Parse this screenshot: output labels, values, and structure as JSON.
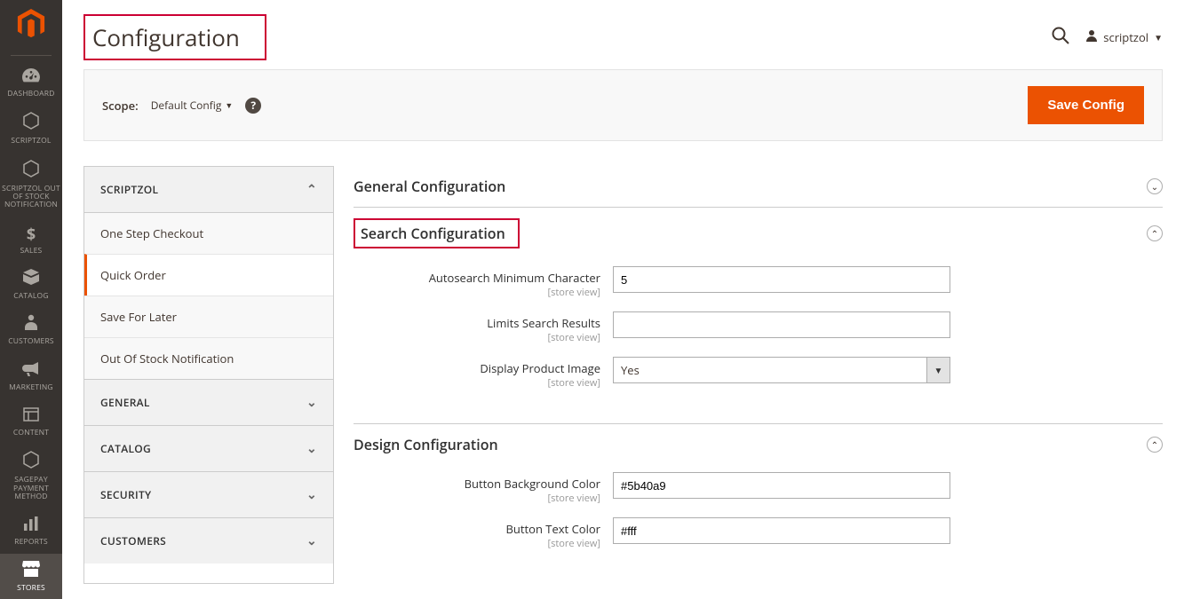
{
  "brand": {
    "color": "#eb5202"
  },
  "nav": {
    "items": [
      {
        "icon": "gauge",
        "label": "DASHBOARD"
      },
      {
        "icon": "hex",
        "label": "SCRIPTZOL"
      },
      {
        "icon": "hex",
        "label": "SCRIPTZOL OUT OF STOCK NOTIFICATION"
      },
      {
        "icon": "dollar",
        "label": "SALES"
      },
      {
        "icon": "cube",
        "label": "CATALOG"
      },
      {
        "icon": "person",
        "label": "CUSTOMERS"
      },
      {
        "icon": "megaphone",
        "label": "MARKETING"
      },
      {
        "icon": "layout",
        "label": "CONTENT"
      },
      {
        "icon": "hex",
        "label": "SAGEPAY PAYMENT METHOD"
      },
      {
        "icon": "bars",
        "label": "REPORTS"
      },
      {
        "icon": "store",
        "label": "STORES"
      }
    ],
    "active_index": 10
  },
  "header": {
    "title": "Configuration",
    "user_name": "scriptzol"
  },
  "scope": {
    "label": "Scope:",
    "value": "Default Config"
  },
  "save_label": "Save Config",
  "config_nav": {
    "sections": [
      {
        "label": "SCRIPTZOL",
        "expanded": true,
        "items": [
          "One Step Checkout",
          "Quick Order",
          "Save For Later",
          "Out Of Stock Notification"
        ],
        "active_item": 1
      },
      {
        "label": "GENERAL",
        "expanded": false
      },
      {
        "label": "CATALOG",
        "expanded": false
      },
      {
        "label": "SECURITY",
        "expanded": false
      },
      {
        "label": "CUSTOMERS",
        "expanded": false
      }
    ]
  },
  "sections": {
    "general": {
      "title": "General Configuration",
      "expanded": false
    },
    "search": {
      "title": "Search Configuration",
      "expanded": true,
      "fields": {
        "autosearch_min": {
          "label": "Autosearch Minimum Character",
          "scope": "[store view]",
          "value": "5"
        },
        "limit_results": {
          "label": "Limits Search Results",
          "scope": "[store view]",
          "value": ""
        },
        "display_image": {
          "label": "Display Product Image",
          "scope": "[store view]",
          "value": "Yes"
        }
      }
    },
    "design": {
      "title": "Design Configuration",
      "expanded": true,
      "fields": {
        "btn_bg": {
          "label": "Button Background Color",
          "scope": "[store view]",
          "value": "#5b40a9"
        },
        "btn_text": {
          "label": "Button Text Color",
          "scope": "[store view]",
          "value": "#fff"
        }
      }
    }
  }
}
